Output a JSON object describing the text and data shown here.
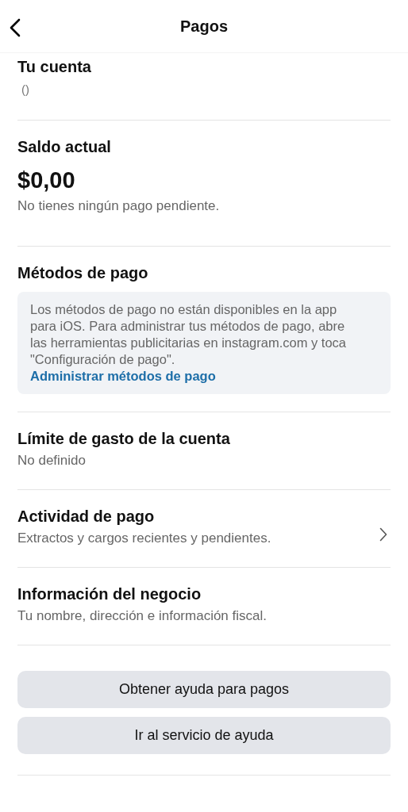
{
  "header": {
    "title": "Pagos"
  },
  "account": {
    "title": "Tu cuenta",
    "value": "()"
  },
  "balance": {
    "title": "Saldo actual",
    "amount": "$0,00",
    "note": "No tienes ningún pago pendiente."
  },
  "payment_methods": {
    "title": "Métodos de pago",
    "notice": "Los métodos de pago no están disponibles en la app para iOS. Para administrar tus métodos de pago, abre las herramientas publicitarias en instagram.com y toca \"Configuración de pago\".",
    "link": "Administrar métodos de pago"
  },
  "items": [
    {
      "title": "Límite de gasto de la cuenta",
      "subtitle": "No definido",
      "chevron": false
    },
    {
      "title": "Actividad de pago",
      "subtitle": "Extractos y cargos recientes y pendientes.",
      "chevron": true
    },
    {
      "title": "Información del negocio",
      "subtitle": "Tu nombre, dirección e información fiscal.",
      "chevron": false
    }
  ],
  "buttons": [
    "Obtener ayuda para pagos",
    "Ir al servicio de ayuda"
  ]
}
